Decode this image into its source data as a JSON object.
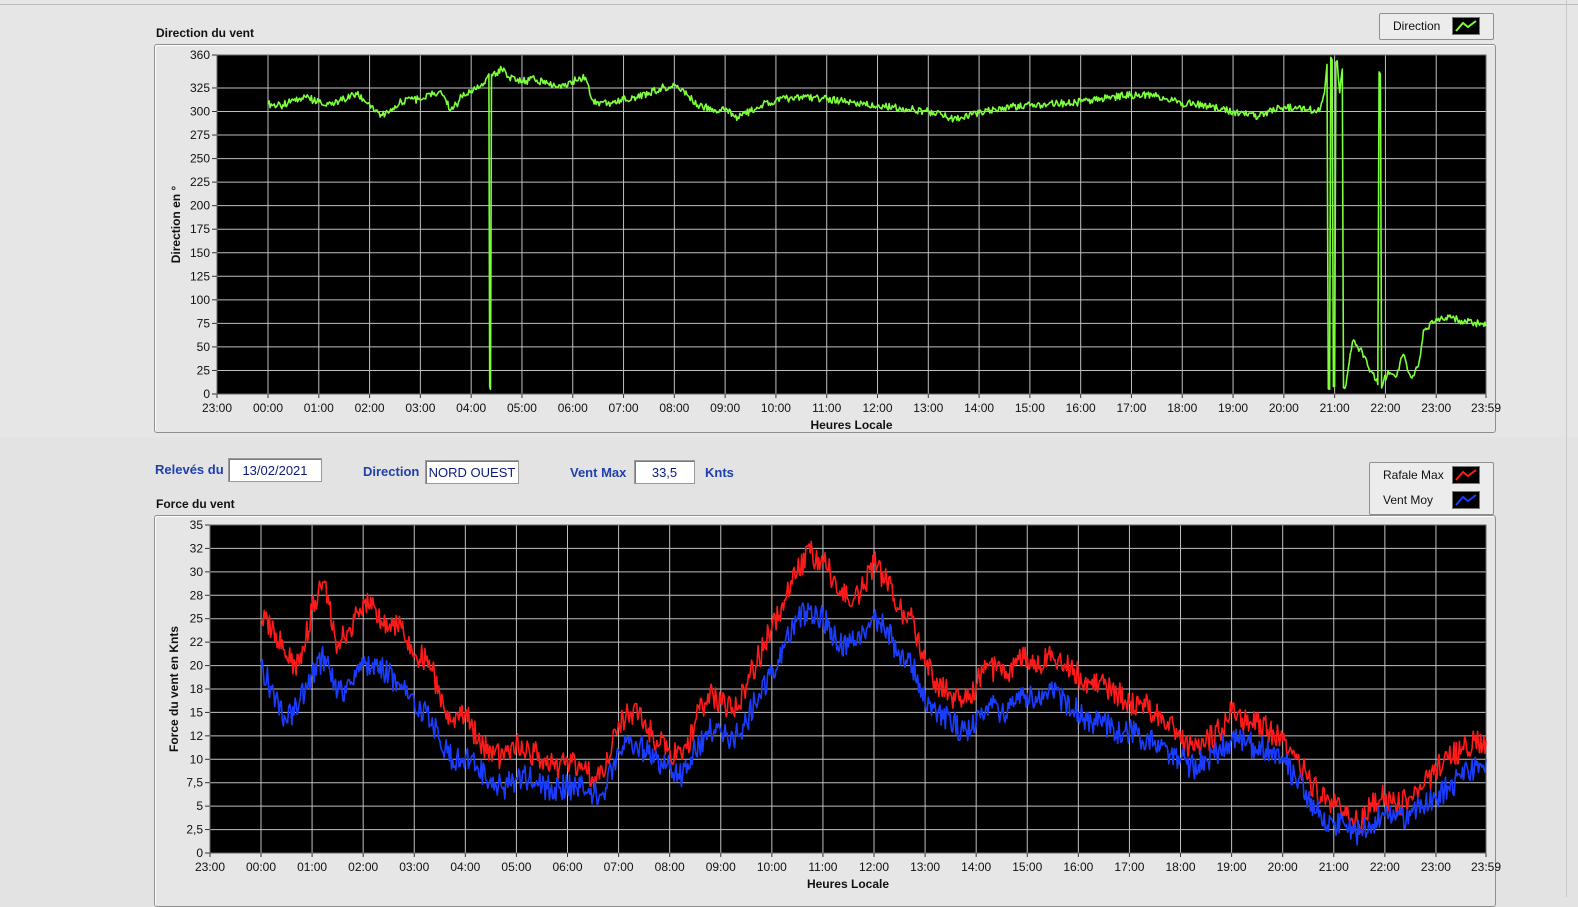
{
  "controls": {
    "releves_label": "Relevés du",
    "releves_value": "13/02/2021",
    "direction_label": "Direction",
    "direction_value": "NORD OUEST",
    "ventmax_label": "Vent Max",
    "ventmax_value": "33,5",
    "ventmax_unit": "Knts"
  },
  "colors": {
    "plot_bg": "#000000",
    "grid": "#c0c0c0",
    "direction": "#7cff3a",
    "rafale": "#ff1a1a",
    "moyen": "#1a3cff",
    "label_blue": "#1f3fae"
  },
  "chart_data": [
    {
      "type": "line",
      "title": "Direction du vent",
      "xlabel": "Heures Locale",
      "ylabel": "Direction en °",
      "ylim": [
        0,
        360
      ],
      "yticks": [
        0,
        25,
        50,
        75,
        100,
        125,
        150,
        175,
        200,
        225,
        250,
        275,
        300,
        325,
        360
      ],
      "ytick_labels": [
        "0",
        "25",
        "50",
        "75",
        "100",
        "125",
        "150",
        "175",
        "200",
        "225",
        "250",
        "275",
        "300",
        "325",
        "360"
      ],
      "x_tick_labels": [
        "23:00",
        "00:00",
        "01:00",
        "02:00",
        "03:00",
        "04:00",
        "05:00",
        "06:00",
        "07:00",
        "08:00",
        "09:00",
        "10:00",
        "11:00",
        "12:00",
        "13:00",
        "14:00",
        "15:00",
        "16:00",
        "17:00",
        "18:00",
        "19:00",
        "20:00",
        "21:00",
        "22:00",
        "23:00",
        "23:59"
      ],
      "grid": true,
      "legend": {
        "position": "top-right",
        "entries": [
          "Direction"
        ]
      },
      "series": [
        {
          "name": "Direction",
          "color": "#7cff3a",
          "x": [
            0,
            0.25,
            0.5,
            0.75,
            1,
            1.25,
            1.5,
            1.75,
            2,
            2.25,
            2.5,
            2.75,
            3,
            3.25,
            3.4,
            3.6,
            3.75,
            3.85,
            4,
            4.25,
            4.35,
            4.38,
            4.42,
            4.6,
            4.75,
            5,
            5.25,
            5.5,
            5.75,
            6,
            6.25,
            6.4,
            6.5,
            6.75,
            7,
            7.25,
            7.5,
            7.75,
            8,
            8.25,
            8.5,
            8.75,
            9,
            9.25,
            9.5,
            9.75,
            10,
            10.5,
            11,
            11.5,
            12,
            12.5,
            13,
            13.25,
            13.5,
            14,
            14.5,
            15,
            15.5,
            16,
            16.5,
            17,
            17.5,
            18,
            18.5,
            19,
            19.5,
            20,
            20.25,
            20.5,
            20.7,
            20.8,
            20.85,
            20.9,
            20.95,
            21,
            21.05,
            21.1,
            21.15,
            21.2,
            21.35,
            21.5,
            21.65,
            21.75,
            21.85,
            21.9,
            21.95,
            22.05,
            22.2,
            22.35,
            22.5,
            22.65,
            22.75,
            23,
            23.25,
            23.5,
            23.75,
            23.98
          ],
          "y": [
            308,
            306,
            312,
            315,
            310,
            307,
            313,
            318,
            308,
            296,
            306,
            314,
            312,
            318,
            322,
            302,
            310,
            320,
            322,
            330,
            340,
            5,
            338,
            345,
            336,
            332,
            334,
            330,
            328,
            332,
            336,
            312,
            310,
            309,
            313,
            315,
            320,
            325,
            328,
            318,
            306,
            303,
            301,
            294,
            300,
            308,
            312,
            316,
            313,
            310,
            306,
            304,
            300,
            297,
            292,
            298,
            304,
            306,
            308,
            310,
            314,
            318,
            316,
            309,
            306,
            300,
            295,
            305,
            303,
            302,
            300,
            320,
            350,
            5,
            355,
            8,
            354,
            320,
            345,
            6,
            55,
            48,
            30,
            22,
            10,
            340,
            10,
            25,
            18,
            42,
            18,
            30,
            68,
            80,
            82,
            78,
            76,
            72
          ]
        }
      ]
    },
    {
      "type": "line",
      "title": "Force du vent",
      "xlabel": "Heures Locale",
      "ylabel": "Force du vent en Knts",
      "ylim": [
        0,
        35
      ],
      "yticks": [
        0,
        2.5,
        5,
        7.5,
        10,
        12.5,
        15,
        17.5,
        20,
        22.5,
        25,
        27.5,
        30,
        32.5,
        35
      ],
      "ytick_labels": [
        "0",
        "2,5",
        "5",
        "7,5",
        "10",
        "12",
        "15",
        "18",
        "20",
        "22",
        "25",
        "28",
        "30",
        "32",
        "35"
      ],
      "x_tick_labels": [
        "23:00",
        "00:00",
        "01:00",
        "02:00",
        "03:00",
        "04:00",
        "05:00",
        "06:00",
        "07:00",
        "08:00",
        "09:00",
        "10:00",
        "11:00",
        "12:00",
        "13:00",
        "14:00",
        "15:00",
        "16:00",
        "17:00",
        "18:00",
        "19:00",
        "20:00",
        "21:00",
        "22:00",
        "23:00",
        "23:59"
      ],
      "grid": true,
      "legend": {
        "position": "top-right",
        "entries": [
          "Rafale Max",
          "Vent Moy"
        ]
      },
      "series": [
        {
          "name": "Rafale Max",
          "color": "#ff1a1a",
          "x": [
            0,
            0.25,
            0.5,
            0.75,
            1,
            1.25,
            1.5,
            1.75,
            2,
            2.25,
            2.5,
            2.75,
            3,
            3.25,
            3.5,
            3.75,
            4,
            4.25,
            4.5,
            4.75,
            5,
            5.25,
            5.5,
            5.75,
            6,
            6.25,
            6.5,
            6.75,
            7,
            7.25,
            7.5,
            7.75,
            8,
            8.25,
            8.5,
            8.75,
            9,
            9.25,
            9.5,
            9.75,
            10,
            10.25,
            10.5,
            10.75,
            11,
            11.25,
            11.5,
            11.75,
            12,
            12.25,
            12.5,
            12.75,
            13,
            13.25,
            13.5,
            13.75,
            14,
            14.25,
            14.5,
            14.75,
            15,
            15.25,
            15.5,
            15.75,
            16,
            16.25,
            16.5,
            16.75,
            17,
            17.25,
            17.5,
            17.75,
            18,
            18.25,
            18.5,
            18.75,
            19,
            19.25,
            19.5,
            19.75,
            20,
            20.25,
            20.5,
            20.75,
            21,
            21.25,
            21.5,
            21.75,
            22,
            22.25,
            22.5,
            22.75,
            23,
            23.25,
            23.5,
            23.75,
            23.98
          ],
          "y": [
            25,
            24,
            21,
            20,
            26,
            29,
            22,
            24,
            27,
            26,
            24,
            24,
            21,
            21,
            17,
            14,
            15,
            12,
            11,
            10,
            12,
            11,
            10,
            9,
            10,
            9,
            8,
            9,
            14,
            15,
            14,
            12,
            11,
            10,
            14,
            17,
            16,
            15,
            18,
            21,
            24,
            27,
            30,
            32,
            31,
            29,
            27,
            28,
            31,
            29,
            26,
            25,
            20,
            18,
            17,
            16,
            18,
            20,
            19,
            20,
            21,
            20,
            21,
            20,
            19,
            18,
            18,
            17,
            16,
            16,
            15,
            14,
            12,
            11,
            12,
            13,
            15,
            14,
            14,
            13,
            12,
            10,
            8,
            6,
            5,
            4,
            3,
            5,
            6,
            5,
            6,
            7,
            9,
            10,
            11,
            12,
            12
          ]
        },
        {
          "name": "Vent Moy",
          "color": "#1a3cff",
          "x": [
            0,
            0.25,
            0.5,
            0.75,
            1,
            1.25,
            1.5,
            1.75,
            2,
            2.25,
            2.5,
            2.75,
            3,
            3.25,
            3.5,
            3.75,
            4,
            4.25,
            4.5,
            4.75,
            5,
            5.25,
            5.5,
            5.75,
            6,
            6.25,
            6.5,
            6.75,
            7,
            7.25,
            7.5,
            7.75,
            8,
            8.25,
            8.5,
            8.75,
            9,
            9.25,
            9.5,
            9.75,
            10,
            10.25,
            10.5,
            10.75,
            11,
            11.25,
            11.5,
            11.75,
            12,
            12.25,
            12.5,
            12.75,
            13,
            13.25,
            13.5,
            13.75,
            14,
            14.25,
            14.5,
            14.75,
            15,
            15.25,
            15.5,
            15.75,
            16,
            16.25,
            16.5,
            16.75,
            17,
            17.25,
            17.5,
            17.75,
            18,
            18.25,
            18.5,
            18.75,
            19,
            19.25,
            19.5,
            19.75,
            20,
            20.25,
            20.5,
            20.75,
            21,
            21.25,
            21.5,
            21.75,
            22,
            22.25,
            22.5,
            22.75,
            23,
            23.25,
            23.5,
            23.75,
            23.98
          ],
          "y": [
            20,
            17,
            14,
            16,
            19,
            21,
            17,
            18,
            20,
            20,
            19,
            18,
            16,
            15,
            12,
            10,
            10,
            9,
            8,
            7,
            8,
            8,
            7,
            7,
            7,
            7,
            6,
            7,
            11,
            12,
            11,
            10,
            9,
            8,
            11,
            13,
            13,
            12,
            14,
            17,
            19,
            22,
            25,
            26,
            25,
            23,
            22,
            23,
            25,
            24,
            21,
            20,
            16,
            15,
            14,
            13,
            14,
            16,
            15,
            16,
            17,
            16,
            17,
            16,
            15,
            14,
            14,
            13,
            13,
            12,
            12,
            11,
            10,
            9,
            10,
            11,
            12,
            12,
            11,
            11,
            10,
            8,
            6,
            4,
            3,
            3,
            2,
            3,
            4,
            4,
            4,
            5,
            6,
            7,
            8,
            9,
            10
          ]
        }
      ]
    }
  ]
}
